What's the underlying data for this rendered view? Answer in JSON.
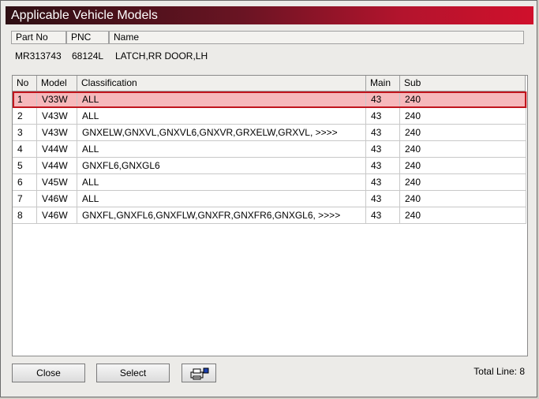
{
  "window": {
    "title": "Applicable Vehicle Models"
  },
  "part": {
    "headers": {
      "part_no": "Part No",
      "pnc": "PNC",
      "name": "Name"
    },
    "values": {
      "part_no": "MR313743",
      "pnc": "68124L",
      "name": "LATCH,RR DOOR,LH"
    }
  },
  "table": {
    "headers": {
      "no": "No",
      "model": "Model",
      "classification": "Classification",
      "main": "Main",
      "sub": "Sub"
    },
    "rows": [
      {
        "no": "1",
        "model": "V33W",
        "classification": "ALL",
        "main": "43",
        "sub": "240"
      },
      {
        "no": "2",
        "model": "V43W",
        "classification": "ALL",
        "main": "43",
        "sub": "240"
      },
      {
        "no": "3",
        "model": "V43W",
        "classification": "GNXELW,GNXVL,GNXVL6,GNXVR,GRXELW,GRXVL,  >>>>",
        "main": "43",
        "sub": "240"
      },
      {
        "no": "4",
        "model": "V44W",
        "classification": "ALL",
        "main": "43",
        "sub": "240"
      },
      {
        "no": "5",
        "model": "V44W",
        "classification": "GNXFL6,GNXGL6",
        "main": "43",
        "sub": "240"
      },
      {
        "no": "6",
        "model": "V45W",
        "classification": "ALL",
        "main": "43",
        "sub": "240"
      },
      {
        "no": "7",
        "model": "V46W",
        "classification": "ALL",
        "main": "43",
        "sub": "240"
      },
      {
        "no": "8",
        "model": "V46W",
        "classification": "GNXFL,GNXFL6,GNXFLW,GNXFR,GNXFR6,GNXGL6,  >>>>",
        "main": "43",
        "sub": "240"
      }
    ],
    "selected_row": 1
  },
  "buttons": {
    "close": "Close",
    "select": "Select"
  },
  "footer": {
    "total_lines": "Total Line: 8"
  },
  "colors": {
    "selection_fill": "#f6b8bb",
    "selection_border": "#c0151d",
    "title_gradient_end": "#d0102c"
  }
}
